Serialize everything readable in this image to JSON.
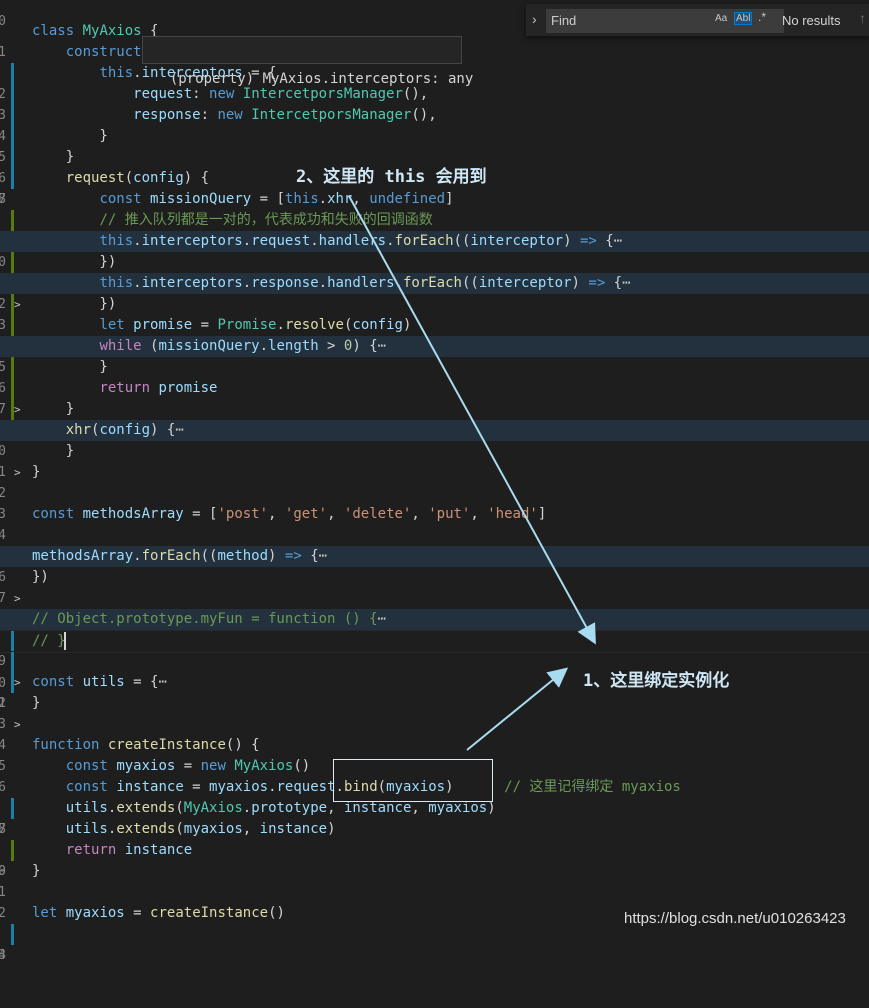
{
  "find": {
    "placeholder": "Find",
    "match_case": "Aa",
    "whole_word": "Abl",
    "regex": ".*",
    "result": "No results",
    "expand_icon": "chevron-right",
    "prev_icon": "arrow-up"
  },
  "hover": {
    "text": "(property) MyAxios.interceptors: any"
  },
  "gutter": [
    "0",
    "1",
    "2",
    "3",
    "4",
    "5",
    "6",
    "7",
    "8",
    "9",
    "0",
    "1",
    "2",
    "3",
    "4",
    "5",
    "6",
    "7",
    "8",
    "9",
    "0",
    "1",
    "2",
    "3",
    "4",
    "5",
    "6",
    "7",
    "8",
    "9",
    "0",
    "1",
    "2",
    "3",
    "4",
    "5",
    "6",
    "7",
    "8",
    "9",
    "0",
    "1",
    "2",
    "3",
    "4"
  ],
  "annotations": {
    "note2": "2、这里的 this 会用到",
    "note1": "1、这里绑定实例化"
  },
  "watermark": "https://blog.csdn.net/u010263423",
  "colors": {
    "keyword": "#569cd6",
    "control": "#c586c0",
    "class": "#4ec9b0",
    "function": "#dcdcaa",
    "variable": "#9cdcfe",
    "string": "#ce9178",
    "comment": "#6a9955",
    "arrow": "#a8dbef",
    "background": "#1e1e1e"
  }
}
